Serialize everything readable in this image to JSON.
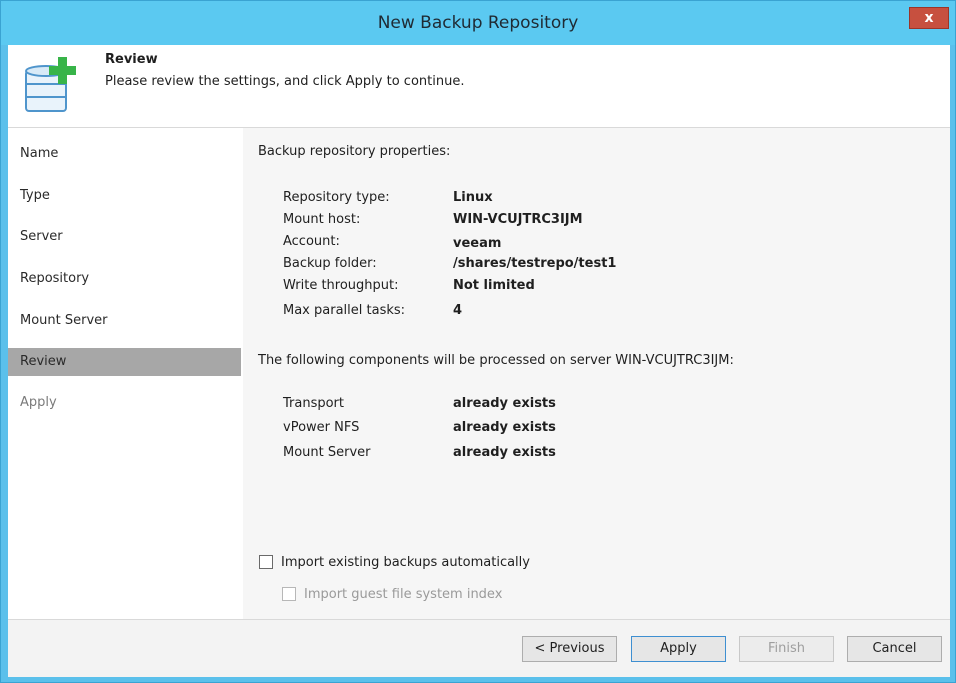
{
  "window": {
    "title": "New Backup Repository",
    "close_label": "x"
  },
  "header": {
    "title": "Review",
    "subtitle": "Please review the settings, and click Apply to continue.",
    "icon": "database-add-icon"
  },
  "sidebar": {
    "items": [
      {
        "label": "Name",
        "state": "normal"
      },
      {
        "label": "Type",
        "state": "normal"
      },
      {
        "label": "Server",
        "state": "normal"
      },
      {
        "label": "Repository",
        "state": "normal"
      },
      {
        "label": "Mount Server",
        "state": "normal"
      },
      {
        "label": "Review",
        "state": "active"
      },
      {
        "label": "Apply",
        "state": "disabled"
      }
    ]
  },
  "content": {
    "properties_heading": "Backup repository properties:",
    "properties": [
      {
        "label": "Repository type:",
        "value": "Linux"
      },
      {
        "label": "Mount host:",
        "value": "WIN-VCUJTRC3IJM"
      },
      {
        "label": "Account:",
        "value": "veeam"
      },
      {
        "label": "Backup folder:",
        "value": "/shares/testrepo/test1"
      },
      {
        "label": "Write throughput:",
        "value": "Not limited"
      },
      {
        "label": "Max parallel tasks:",
        "value": "4"
      }
    ],
    "components_heading": "The following components will be processed on server WIN-VCUJTRC3IJM:",
    "components": [
      {
        "label": "Transport",
        "value": "already exists"
      },
      {
        "label": "vPower NFS",
        "value": "already exists"
      },
      {
        "label": "Mount Server",
        "value": "already exists"
      }
    ],
    "import_backups_label": "Import existing backups automatically",
    "import_index_label": "Import guest file system index"
  },
  "footer": {
    "previous_label": "< Previous",
    "apply_label": "Apply",
    "finish_label": "Finish",
    "cancel_label": "Cancel"
  },
  "colors": {
    "titlebar": "#5bc9f1",
    "active_step": "#a7a7a7",
    "content_bg": "#f6f6f6",
    "icon_green": "#38b449",
    "icon_blue": "#5aa3d8"
  }
}
